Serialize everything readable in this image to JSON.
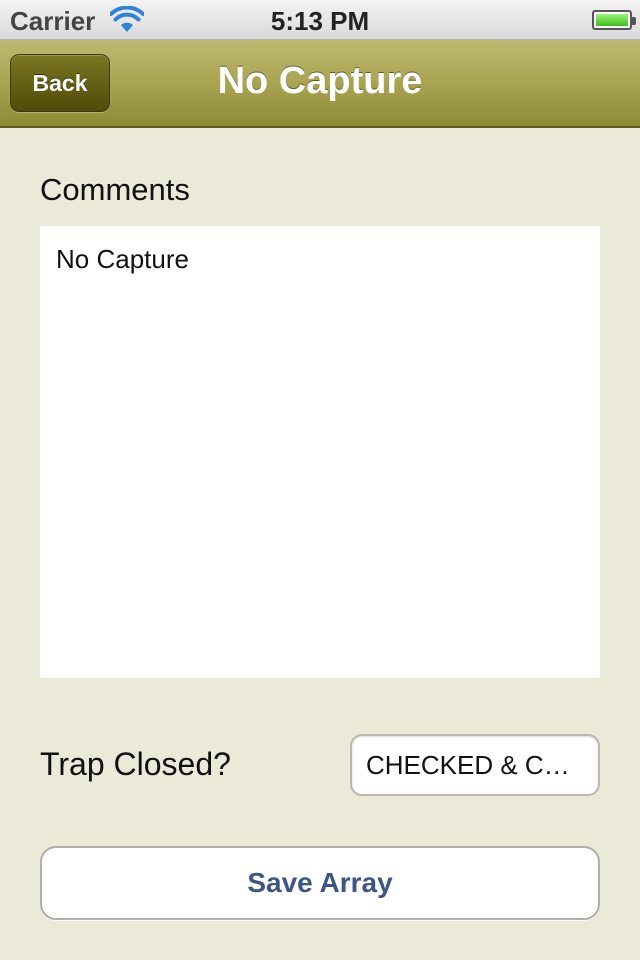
{
  "status_bar": {
    "carrier": "Carrier",
    "time": "5:13 PM",
    "battery_level": 1.0
  },
  "nav_bar": {
    "back_label": "Back",
    "title": "No Capture"
  },
  "form": {
    "comments_label": "Comments",
    "comments_value": "No Capture",
    "trap_closed_label": "Trap Closed?",
    "trap_closed_value": "CHECKED & C…",
    "save_label": "Save Array"
  },
  "colors": {
    "nav_accent": "#a9a452",
    "background": "#ebe9d8",
    "save_text": "#3b5587"
  }
}
